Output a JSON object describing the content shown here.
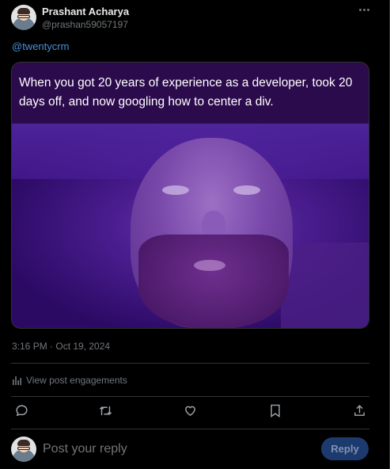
{
  "post": {
    "author_name": "Prashant Acharya",
    "author_handle": "@prashan59057197",
    "mention": "@twentycrm",
    "media_caption": "When you got 20 years of experience as a developer, took 20 days off, and now googling how to center a div.",
    "timestamp": "3:16 PM · Oct 19, 2024",
    "view_engagements": "View post engagements"
  },
  "reply": {
    "placeholder": "Post your reply",
    "button_label": "Reply"
  },
  "colors": {
    "accent_link": "#4c8fd8",
    "reply_button_bg": "#1d3a6e"
  },
  "icons": [
    "more-icon",
    "reply-icon",
    "repost-icon",
    "like-icon",
    "bookmark-icon",
    "share-icon",
    "chart-icon"
  ]
}
